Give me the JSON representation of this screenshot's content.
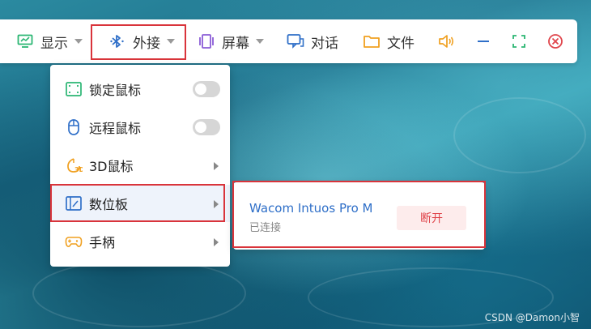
{
  "toolbar": {
    "display_label": "显示",
    "external_label": "外接",
    "screen_label": "屏幕",
    "chat_label": "对话",
    "file_label": "文件",
    "icons": {
      "display": "monitor-icon",
      "external": "bluetooth-icon",
      "screen": "screen-icon",
      "chat": "chat-icon",
      "file": "folder-icon",
      "volume": "volume-icon",
      "minimize": "minimize-icon",
      "fullscreen": "fullscreen-icon",
      "close": "close-icon"
    }
  },
  "menu": {
    "items": [
      {
        "label": "锁定鼠标",
        "icon": "lock-mouse-icon",
        "control": "toggle",
        "state": "off"
      },
      {
        "label": "远程鼠标",
        "icon": "mouse-icon",
        "control": "toggle",
        "state": "off"
      },
      {
        "label": "3D鼠标",
        "icon": "3d-mouse-icon",
        "control": "submenu"
      },
      {
        "label": "数位板",
        "icon": "tablet-icon",
        "control": "submenu"
      },
      {
        "label": "手柄",
        "icon": "gamepad-icon",
        "control": "submenu"
      }
    ]
  },
  "submenu": {
    "device_name": "Wacom Intuos Pro M",
    "status": "已连接",
    "disconnect_label": "断开"
  },
  "watermark": "CSDN @Damon小智",
  "colors": {
    "highlight": "#d9343b",
    "green_icon": "#2bb673",
    "blue_icon": "#2f6fc8",
    "purple_icon": "#8a5cd6",
    "orange_icon": "#f0a020",
    "close_red": "#e0454b"
  }
}
